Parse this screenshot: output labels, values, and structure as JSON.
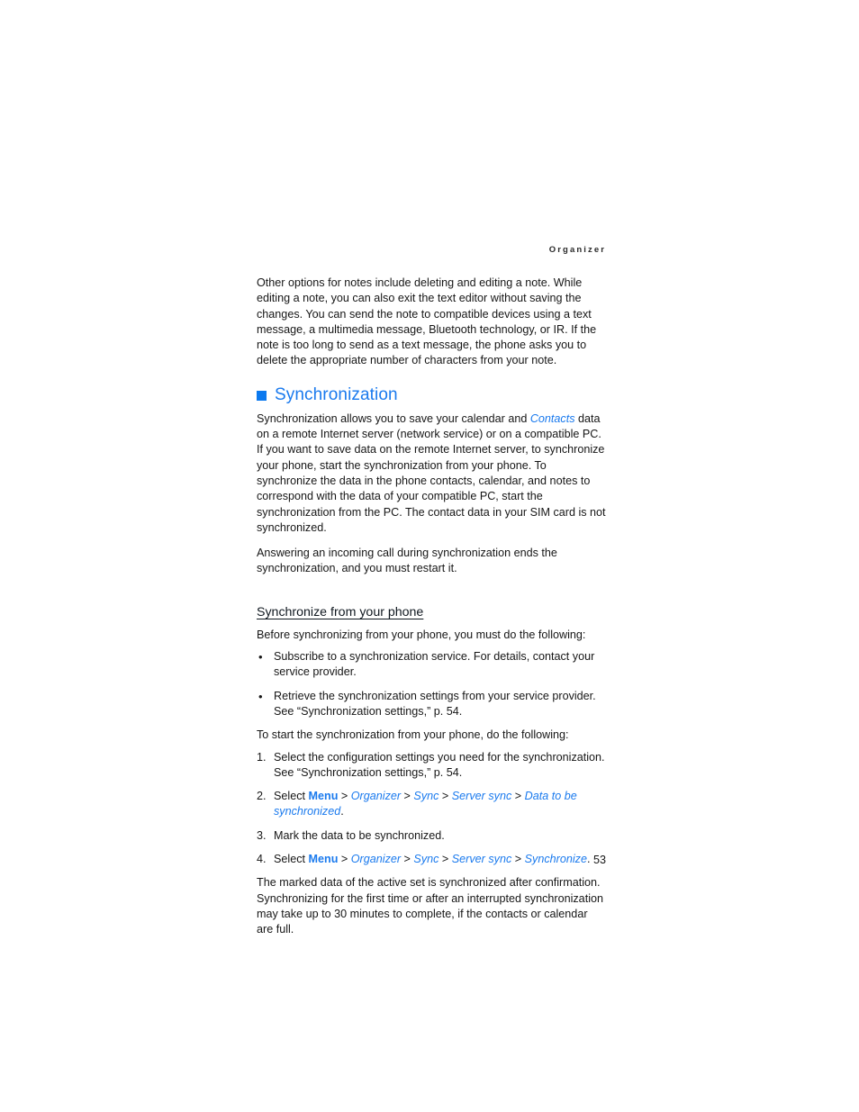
{
  "running_header": "Organizer",
  "page_number": "53",
  "colors": {
    "accent_blue": "#1a7aee",
    "bullet_square": "#0b79ef",
    "body_text": "#161616",
    "header_text": "#2a2a2a"
  },
  "intro_paragraph": "Other options for notes include deleting and editing a note. While editing a note, you can also exit the text editor without saving the changes. You can send the note to compatible devices using a text message, a multimedia message, Bluetooth technology, or IR. If the note is too long to send as a text message, the phone asks you to delete the appropriate number of characters from your note.",
  "section": {
    "heading": "Synchronization",
    "paragraph_1_part_1": "Synchronization allows you to save your calendar and ",
    "paragraph_1_contacts": "Contacts",
    "paragraph_1_part_2": " data on a remote Internet server (network service) or on a compatible PC. If you want to save data on the remote Internet server, to synchronize your phone, start the synchronization from your phone. To synchronize the data in the phone contacts, calendar, and notes to correspond with the data of your compatible PC, start the synchronization from the PC. The contact data in your SIM card is not synchronized.",
    "paragraph_2": "Answering an incoming call during synchronization ends the synchronization, and you must restart it."
  },
  "subsection": {
    "heading": "Synchronize from your phone",
    "intro": "Before synchronizing from your phone, you must do the following:",
    "bullets": [
      {
        "marker": "•",
        "text": "Subscribe to a synchronization service. For details, contact your service provider."
      },
      {
        "marker": "•",
        "text": "Retrieve the synchronization settings from your service provider. See “Synchronization settings,” p. 54."
      }
    ],
    "steps_intro": "To start the synchronization from your phone, do the following:",
    "steps": [
      {
        "marker": "1.",
        "plain": "Select the configuration settings you need for the synchronization. See “Synchronization settings,” p. 54."
      },
      {
        "marker": "2.",
        "lead": "Select ",
        "path": [
          {
            "label": "Menu",
            "style": "bold"
          },
          {
            "label": "Organizer",
            "style": "italic"
          },
          {
            "label": "Sync",
            "style": "italic"
          },
          {
            "label": "Server sync",
            "style": "italic"
          },
          {
            "label": "Data to be synchronized",
            "style": "italic"
          }
        ],
        "separator": " > ",
        "trailing": "."
      },
      {
        "marker": "3.",
        "plain": "Mark the data to be synchronized."
      },
      {
        "marker": "4.",
        "lead": "Select ",
        "path": [
          {
            "label": "Menu",
            "style": "bold"
          },
          {
            "label": "Organizer",
            "style": "italic"
          },
          {
            "label": "Sync",
            "style": "italic"
          },
          {
            "label": "Server sync",
            "style": "italic"
          },
          {
            "label": "Synchronize",
            "style": "italic"
          }
        ],
        "separator": " > ",
        "trailing": "."
      }
    ],
    "closing_paragraph": "The marked data of the active set is synchronized after confirmation. Synchronizing for the first time or after an interrupted synchronization may take up to 30 minutes to complete, if the contacts or calendar are full."
  }
}
